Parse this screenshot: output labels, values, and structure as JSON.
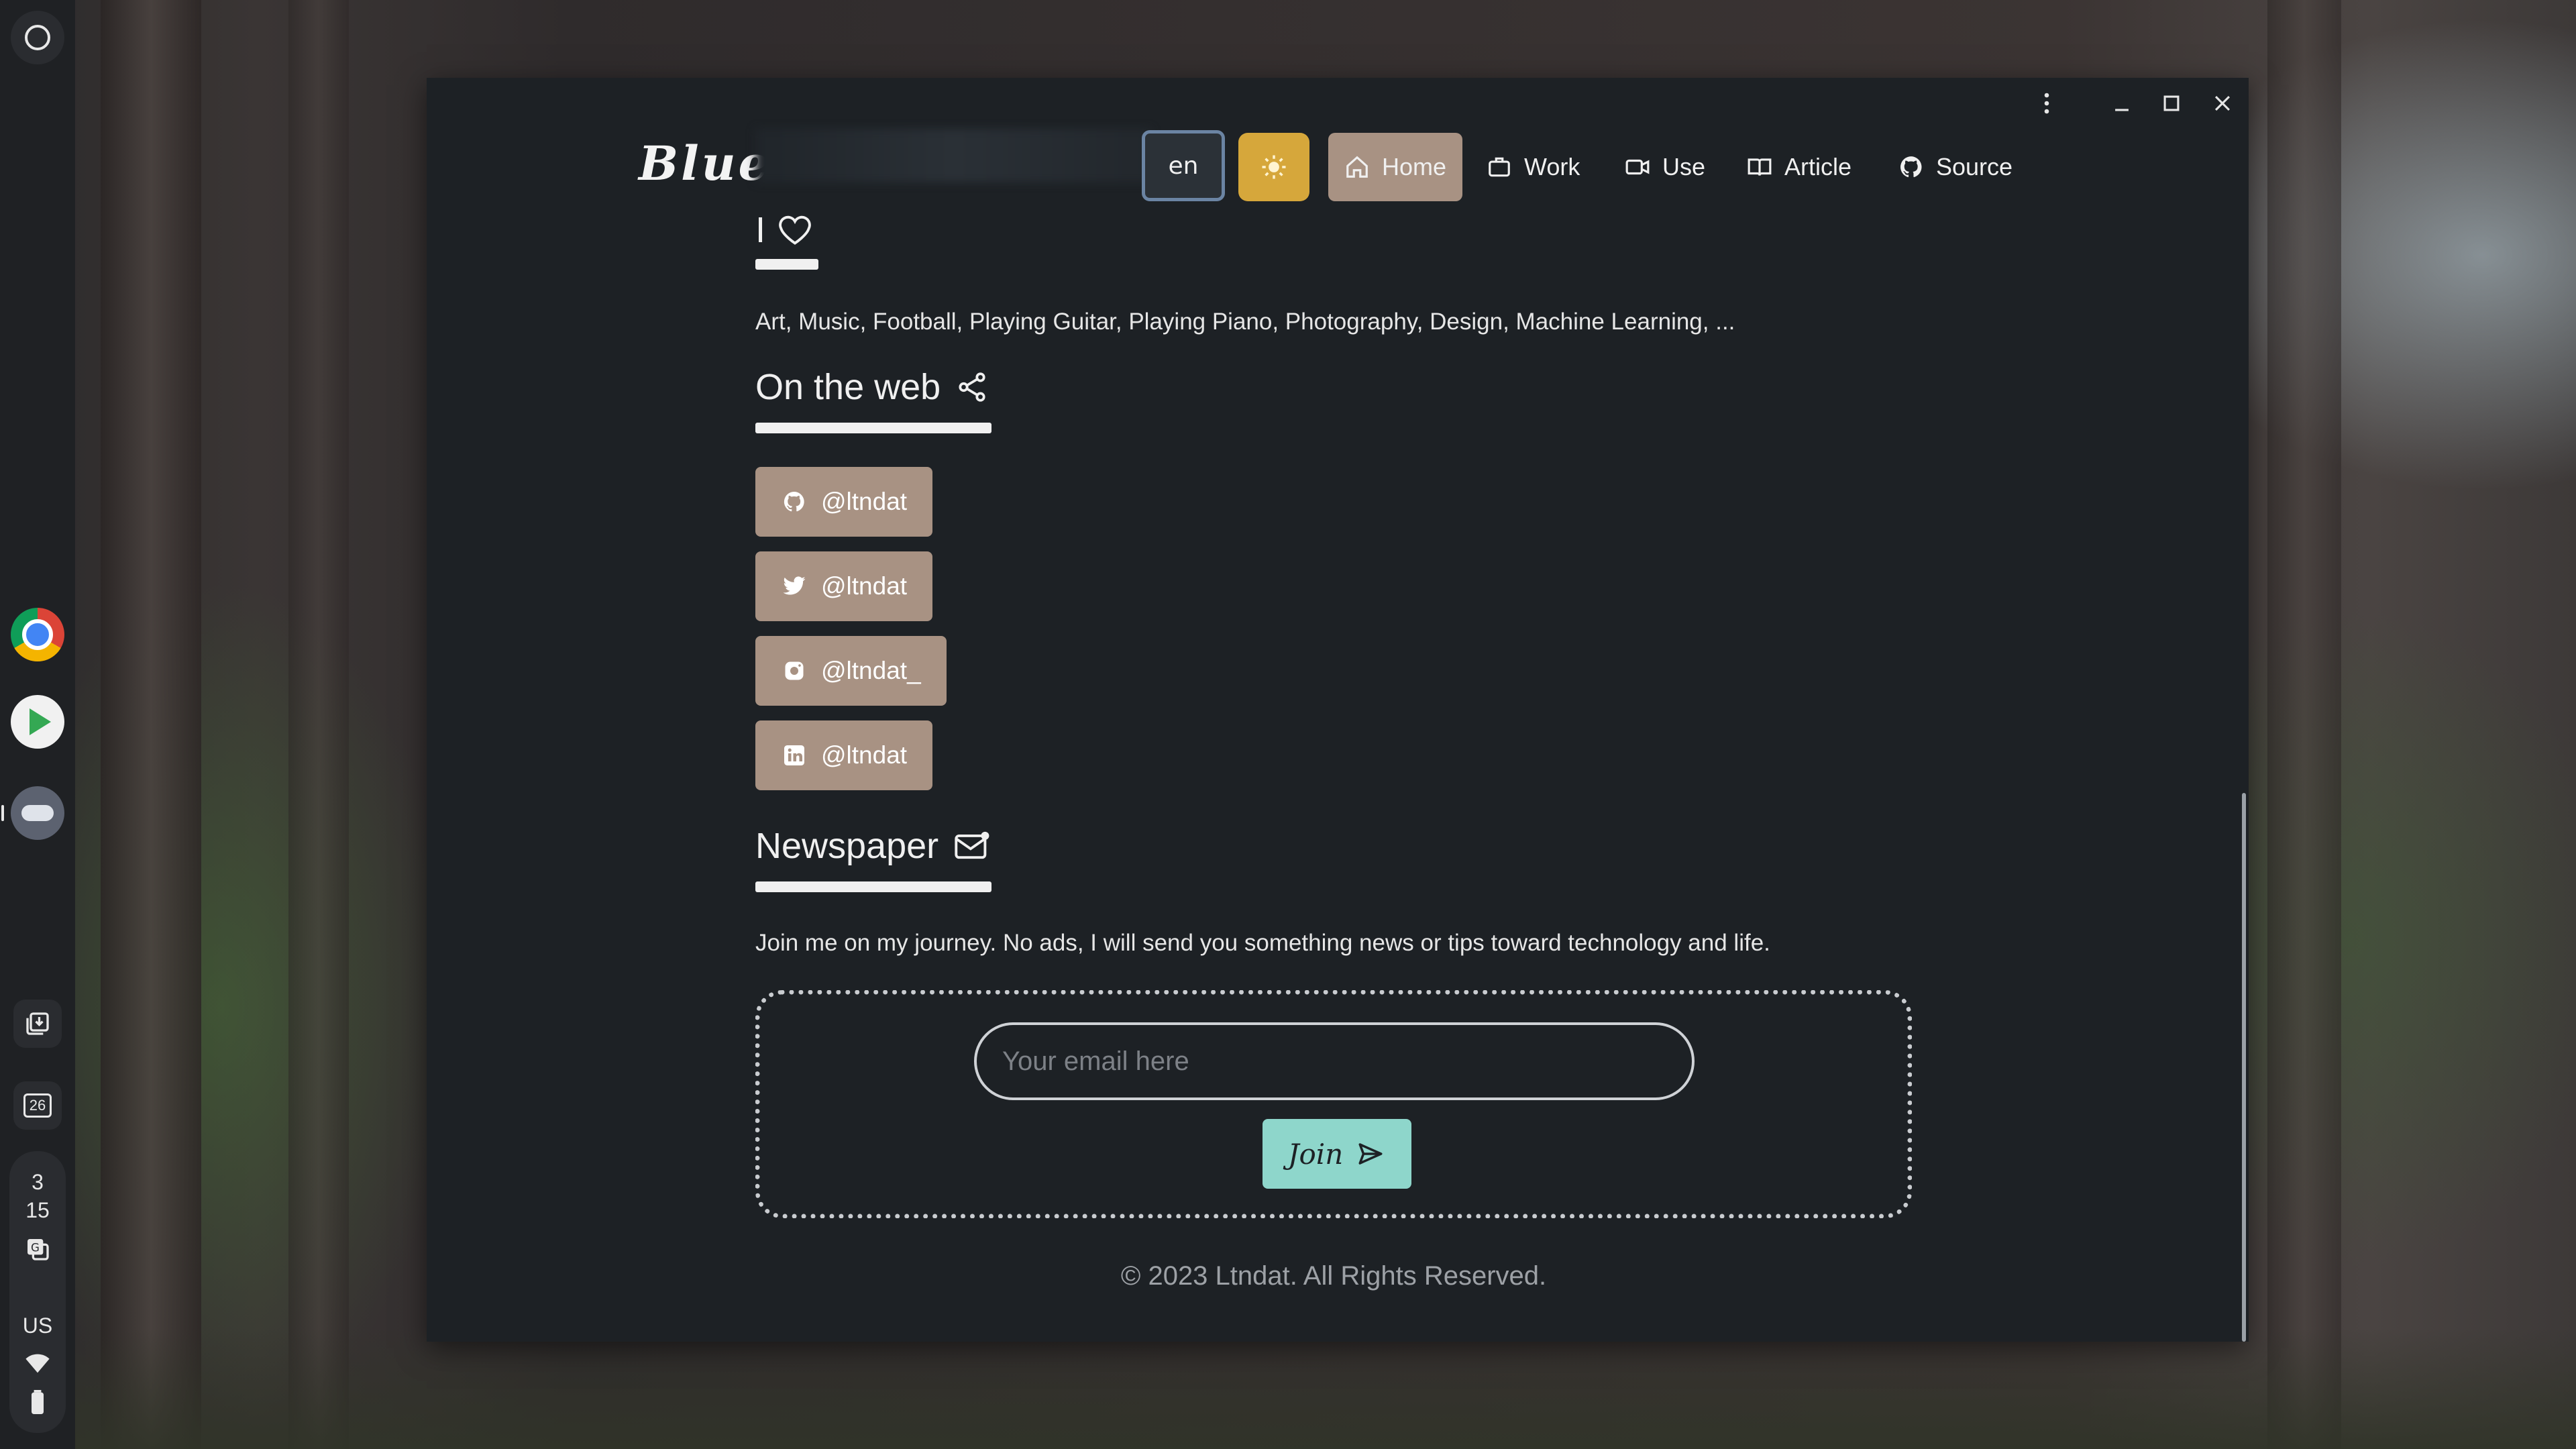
{
  "shelf": {
    "calendar_day": "26",
    "time_hour": "3",
    "time_minute": "15",
    "locale": "US"
  },
  "window": {
    "menu_icon": "more-vert-icon",
    "minimize_icon": "minimize-icon",
    "maximize_icon": "maximize-icon",
    "close_icon": "close-icon"
  },
  "nav": {
    "logo": "Blue",
    "lang": "en",
    "theme_icon": "sun-icon",
    "items": [
      {
        "label": "Home",
        "icon": "home-icon"
      },
      {
        "label": "Work",
        "icon": "briefcase-icon"
      },
      {
        "label": "Use",
        "icon": "video-icon"
      },
      {
        "label": "Article",
        "icon": "book-icon"
      },
      {
        "label": "Source",
        "icon": "github-icon"
      }
    ]
  },
  "love": {
    "heading": "I",
    "heading_icon": "heart-icon",
    "text": "Art, Music, Football, Playing Guitar, Playing Piano, Photography, Design, Machine Learning, ..."
  },
  "web": {
    "heading": "On the web",
    "heading_icon": "share-icon",
    "links": [
      {
        "label": "@ltndat",
        "icon": "github-icon"
      },
      {
        "label": "@ltndat",
        "icon": "twitter-icon"
      },
      {
        "label": "@ltndat_",
        "icon": "instagram-icon"
      },
      {
        "label": "@ltndat",
        "icon": "linkedin-icon"
      }
    ]
  },
  "newspaper": {
    "heading": "Newspaper",
    "heading_icon": "mail-icon",
    "text": "Join me on my journey. No ads, I will send you something news or tips toward technology and life.",
    "email_placeholder": "Your email here",
    "email_value": "",
    "join_label": "Join",
    "join_icon": "send-icon"
  },
  "footer": "© 2023 Ltndat. All Rights Reserved.",
  "colors": {
    "window_bg": "#1d2125",
    "nav_active": "#a89283",
    "theme_button": "#d6a73b",
    "join_button": "#8ed6cb"
  }
}
